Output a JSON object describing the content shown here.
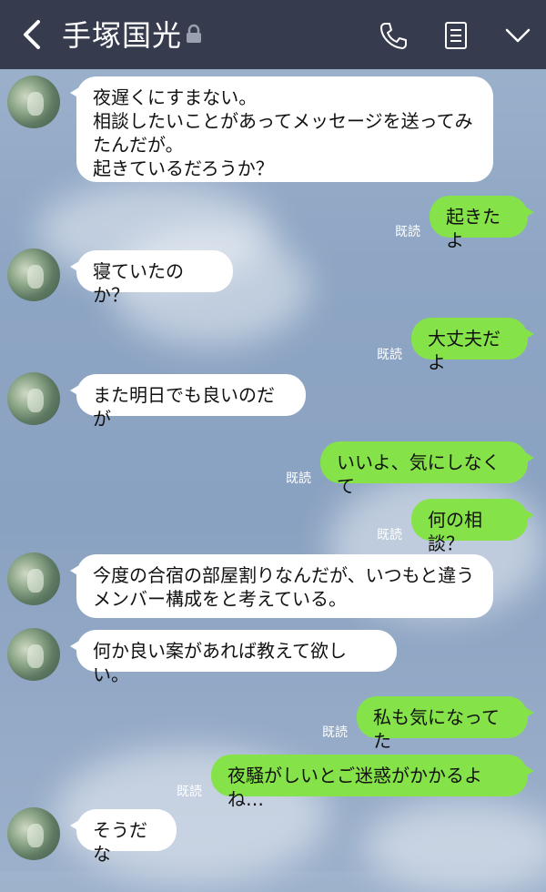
{
  "header": {
    "title": "手塚国光",
    "back_icon": "chevron-left-icon",
    "lock_icon": "lock-icon",
    "call_icon": "phone-icon",
    "notes_icon": "notes-icon",
    "menu_icon": "chevron-down-icon",
    "bg_color": "#363b4e"
  },
  "colors": {
    "sent_bubble": "#85e249",
    "received_bubble": "#ffffff"
  },
  "messages": [
    {
      "dir": "received",
      "text": "夜遅くにすまない。\n相談したいことがあってメッセージを送ってみたんだが。\n起きているだろうか？"
    },
    {
      "dir": "sent",
      "text": "起きたよ",
      "read": "既読"
    },
    {
      "dir": "received",
      "text": "寝ていたのか？"
    },
    {
      "dir": "sent",
      "text": "大丈夫だよ",
      "read": "既読"
    },
    {
      "dir": "received",
      "text": "また明日でも良いのだが"
    },
    {
      "dir": "sent",
      "text": "いいよ、気にしなくて",
      "read": "既読"
    },
    {
      "dir": "sent",
      "text": "何の相談？",
      "read": "既読"
    },
    {
      "dir": "received",
      "text": "今度の合宿の部屋割りなんだが、いつもと違うメンバー構成をと考えている。"
    },
    {
      "dir": "received",
      "text": "何か良い案があれば教えて欲しい。"
    },
    {
      "dir": "sent",
      "text": "私も気になってた",
      "read": "既読"
    },
    {
      "dir": "sent",
      "text": "夜騒がしいとご迷惑がかかるよね…",
      "read": "既読"
    },
    {
      "dir": "received",
      "text": "そうだな"
    }
  ]
}
